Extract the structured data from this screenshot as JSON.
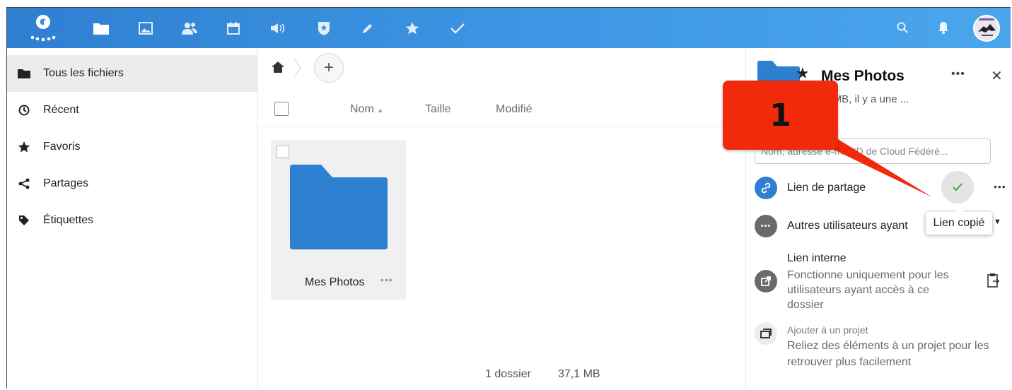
{
  "header": {
    "apps": [
      {
        "name": "files-icon"
      },
      {
        "name": "photos-icon"
      },
      {
        "name": "contacts-icon"
      },
      {
        "name": "calendar-icon"
      },
      {
        "name": "announcements-icon"
      },
      {
        "name": "security-icon"
      },
      {
        "name": "edit-icon"
      },
      {
        "name": "favorites-icon"
      },
      {
        "name": "tasks-icon"
      }
    ],
    "accent": "#3a8fdf"
  },
  "sidebar": {
    "items": [
      {
        "label": "Tous les fichiers",
        "icon": "folder-icon"
      },
      {
        "label": "Récent",
        "icon": "clock-icon"
      },
      {
        "label": "Favoris",
        "icon": "star-icon"
      },
      {
        "label": "Partages",
        "icon": "share-icon"
      },
      {
        "label": "Étiquettes",
        "icon": "tag-icon"
      }
    ]
  },
  "main": {
    "columns": {
      "name": "Nom",
      "sort_indicator": "▲",
      "size": "Taille",
      "modified": "Modifié"
    },
    "tile": {
      "name": "Mes Photos",
      "more": "•••"
    },
    "summary": {
      "folders": "1 dossier",
      "size": "37,1 MB"
    }
  },
  "details": {
    "title": "Mes Photos",
    "subtitle": ",1 MB, il y a une ...",
    "more": "•••",
    "close": "✕",
    "share_placeholder": "Nom, adresse e-m...  ID de Cloud Fédéré...",
    "share_link_label": "Lien de partage",
    "share_link_more": "•••",
    "tooltip": "Lien copié",
    "others_label": "Autres utilisateurs ayant",
    "internal_title": "Lien interne",
    "internal_desc": "Fonctionne uniquement pour les utilisateurs ayant accès à ce dossier",
    "project_title": "Ajouter à un projet",
    "project_desc": "Reliez des éléments à un projet pour les retrouver plus facilement"
  },
  "annotation": {
    "label": "1",
    "color": "#f02a0a"
  }
}
